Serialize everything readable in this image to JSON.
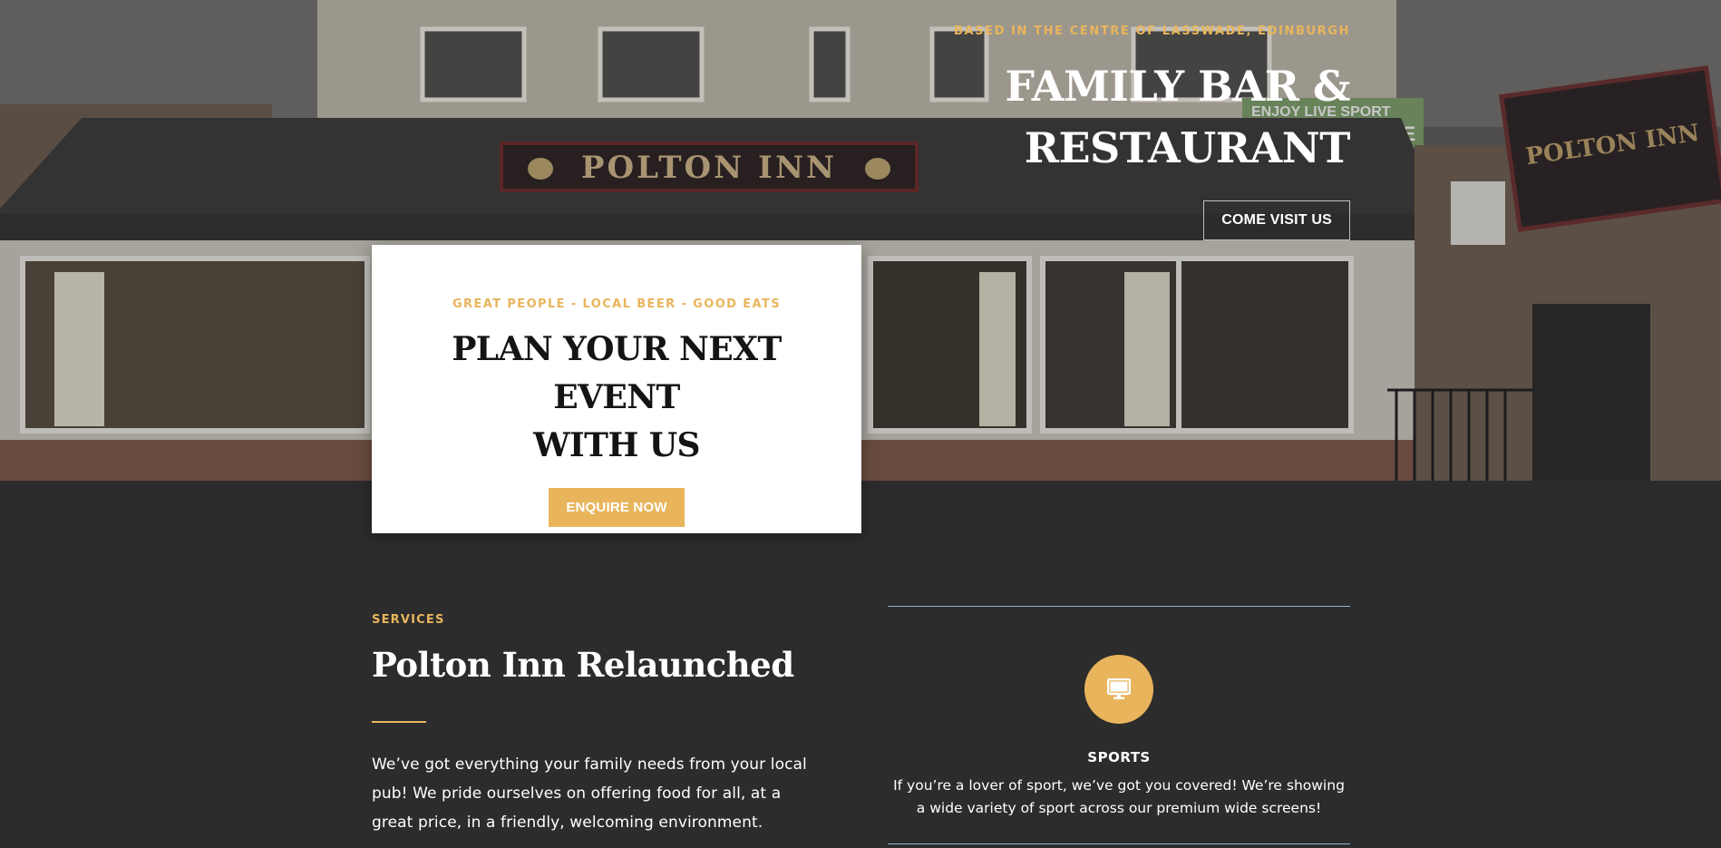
{
  "hero": {
    "kicker": "BASED IN THE CENTRE OF LASSWADE, EDINBURGH",
    "title_line1": "FAMILY BAR &",
    "title_line2": "RESTAURANT",
    "cta_label": "COME VISIT US",
    "photo": {
      "sign_text": "POLTON INN",
      "side_sign_text": "POLTON INN",
      "banner_text_1": "ENJOY LIVE SPORT",
      "banner_text_2": "HERE",
      "icon": "pub-exterior-photo"
    }
  },
  "event_card": {
    "kicker": "GREAT PEOPLE - LOCAL BEER - GOOD EATS",
    "title_line1": "PLAN YOUR NEXT EVENT",
    "title_line2": "WITH US",
    "cta_label": "ENQUIRE NOW"
  },
  "services": {
    "kicker": "SERVICES",
    "title": "Polton Inn Relaunched",
    "text_line1": "We’ve got everything your family needs from your local",
    "text_line2": "pub! We pride ourselves on offering food for all, at a",
    "text_line3": "great price, in a friendly, welcoming environment.",
    "items": [
      {
        "icon": "monitor-icon",
        "title": "SPORTS",
        "text_line1": "If you’re a lover of sport, we’ve got you covered! We’re showing",
        "text_line2": "a wide variety of sport across our premium wide screens!"
      }
    ]
  },
  "colors": {
    "accent": "#e8b55c",
    "background": "#2c2c2c",
    "card": "#ffffff",
    "rule": "#8fb6c4"
  }
}
